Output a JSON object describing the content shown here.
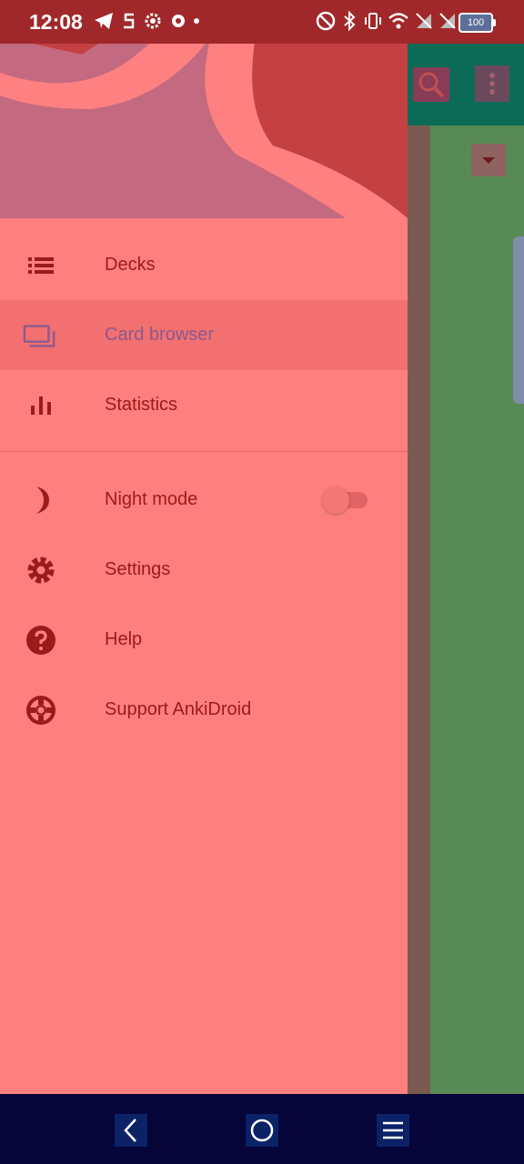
{
  "status_bar": {
    "time": "12:08",
    "battery_level": "100",
    "icons": [
      "telegram-icon",
      "s-app-icon",
      "settings-icon",
      "settings-icon",
      "dot-icon",
      "nfc-icon",
      "bluetooth-icon",
      "vibrate-icon",
      "wifi-icon",
      "no-sim-icon",
      "no-sim-icon",
      "battery-icon"
    ]
  },
  "drawer": {
    "items": [
      {
        "label": "Decks",
        "icon": "list-icon"
      },
      {
        "label": "Card browser",
        "icon": "card-browser-icon",
        "selected": true
      },
      {
        "label": "Statistics",
        "icon": "bar-chart-icon"
      }
    ],
    "secondary_items": [
      {
        "label": "Night mode",
        "icon": "moon-icon",
        "toggle": false
      },
      {
        "label": "Settings",
        "icon": "gear-icon"
      },
      {
        "label": "Help",
        "icon": "help-icon"
      },
      {
        "label": "Support AnkiDroid",
        "icon": "lifebuoy-icon"
      }
    ]
  },
  "colors": {
    "drawer_bg": "#ff7f7e",
    "item_text": "#9c1a1c",
    "selected_text": "#8c5a8f",
    "status_bar": "#a0282a",
    "nav_bar": "#05053a"
  },
  "nav_bar": {
    "buttons": [
      "back-icon",
      "home-icon",
      "recents-icon"
    ]
  }
}
